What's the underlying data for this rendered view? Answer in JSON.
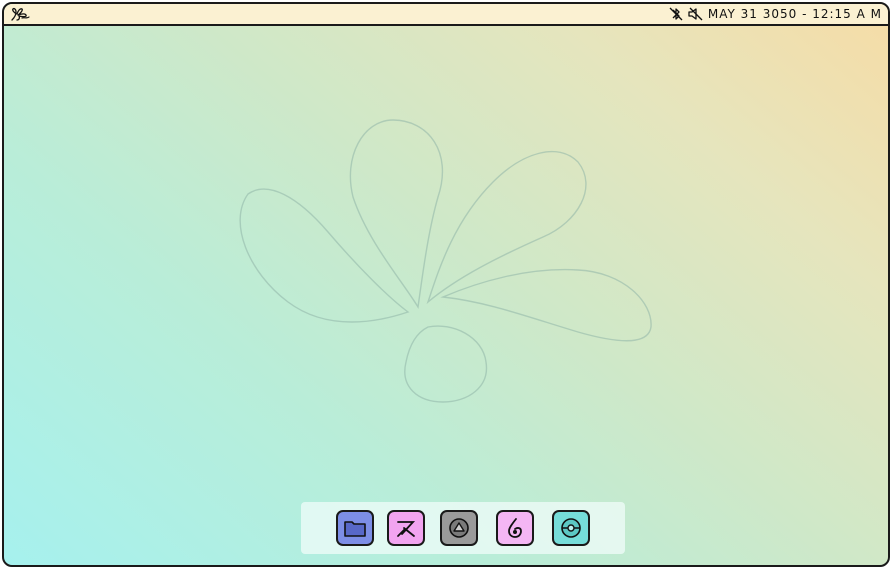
{
  "topbar": {
    "logo_icon": "swirl-logo-icon",
    "status_icons": [
      "bluetooth-off-icon",
      "volume-muted-icon"
    ],
    "datetime": "MAY 31 3050 - 12:15 A M"
  },
  "desktop": {
    "wallpaper": "petal-flower-line-art"
  },
  "dock": {
    "items": [
      {
        "name": "files",
        "icon": "folder-icon",
        "color": "#7d8ee6"
      },
      {
        "name": "tools",
        "icon": "scissors-pen-icon",
        "color": "#f2a4f0"
      },
      {
        "name": "drive",
        "icon": "disc-triangle-icon",
        "color": "#9a9a9a"
      },
      {
        "name": "paint",
        "icon": "drop-icon",
        "color": "#f4b6f4"
      },
      {
        "name": "browser",
        "icon": "globe-ball-icon",
        "color": "#76ddd9"
      }
    ]
  },
  "colors": {
    "topbar_bg": "#fbf1d2",
    "gradient_start": "#a6f1ee",
    "gradient_end": "#f6dca6",
    "outline": "#1a1a1a"
  }
}
